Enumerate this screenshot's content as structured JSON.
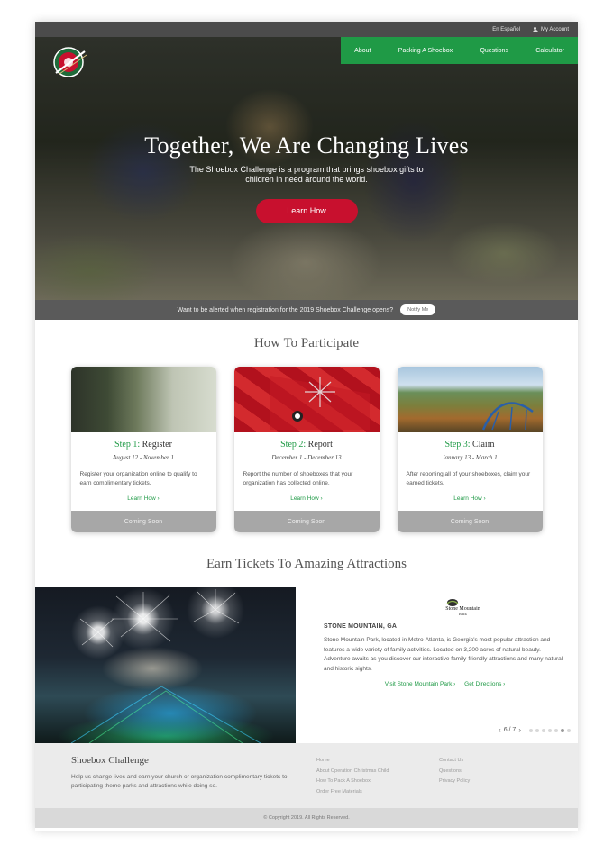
{
  "topbar": {
    "language": "En Español",
    "account": "My Account"
  },
  "nav": [
    "About",
    "Packing A Shoebox",
    "Questions",
    "Calculator"
  ],
  "hero": {
    "title": "Together, We Are Changing Lives",
    "subtitle": "The Shoebox Challenge is a program that brings shoebox gifts to children in need around the world.",
    "cta": "Learn How"
  },
  "alert": {
    "text": "Want to be alerted when registration for the 2019 Shoebox Challenge opens?",
    "button": "Notify Me"
  },
  "participate": {
    "title": "How To Participate",
    "cards": [
      {
        "step": "Step 1:",
        "name": "Register",
        "dates": "August 12 - November 1",
        "desc": "Register your organization online to qualify to earn complimentary tickets.",
        "link": "Learn How ›",
        "status": "Coming Soon"
      },
      {
        "step": "Step 2:",
        "name": "Report",
        "dates": "December 1 - December 13",
        "desc": "Report the number of shoeboxes that your organization has collected online.",
        "link": "Learn How ›",
        "status": "Coming Soon"
      },
      {
        "step": "Step 3:",
        "name": "Claim",
        "dates": "January 13 - March 1",
        "desc": "After reporting all of your shoeboxes, claim your earned tickets.",
        "link": "Learn How ›",
        "status": "Coming Soon"
      }
    ]
  },
  "attractions": {
    "title": "Earn Tickets To Amazing Attractions",
    "logo_text": "Stone Mountain",
    "logo_sub": "PARK",
    "name": "STONE MOUNTAIN, GA",
    "desc": "Stone Mountain Park, located in Metro-Atlanta, is Georgia's most popular attraction and features a wide variety of family activities. Located on 3,200 acres of natural beauty. Adventure awaits as you discover our interactive family-friendly attractions and many natural and historic sights.",
    "link_visit": "Visit Stone Mountain Park ›",
    "link_directions": "Get Directions ›",
    "pager": "6 / 7",
    "pager_prev": "‹",
    "pager_next": "›",
    "dot_count": 7,
    "active_dot": 6
  },
  "footer": {
    "title": "Shoebox Challenge",
    "text": "Help us change lives and earn your church or organization complimentary tickets to participating theme parks and attractions while doing so.",
    "col1": [
      "Home",
      "About Operation Christmas Child",
      "How To Pack A Shoebox",
      "Order Free Materials"
    ],
    "col2": [
      "Contact Us",
      "Questions",
      "Privacy Policy"
    ],
    "copyright": "© Copyright 2019. All Rights Reserved."
  },
  "colors": {
    "green": "#1f9a46",
    "red": "#c8102e",
    "dark": "#4b4b4b"
  }
}
